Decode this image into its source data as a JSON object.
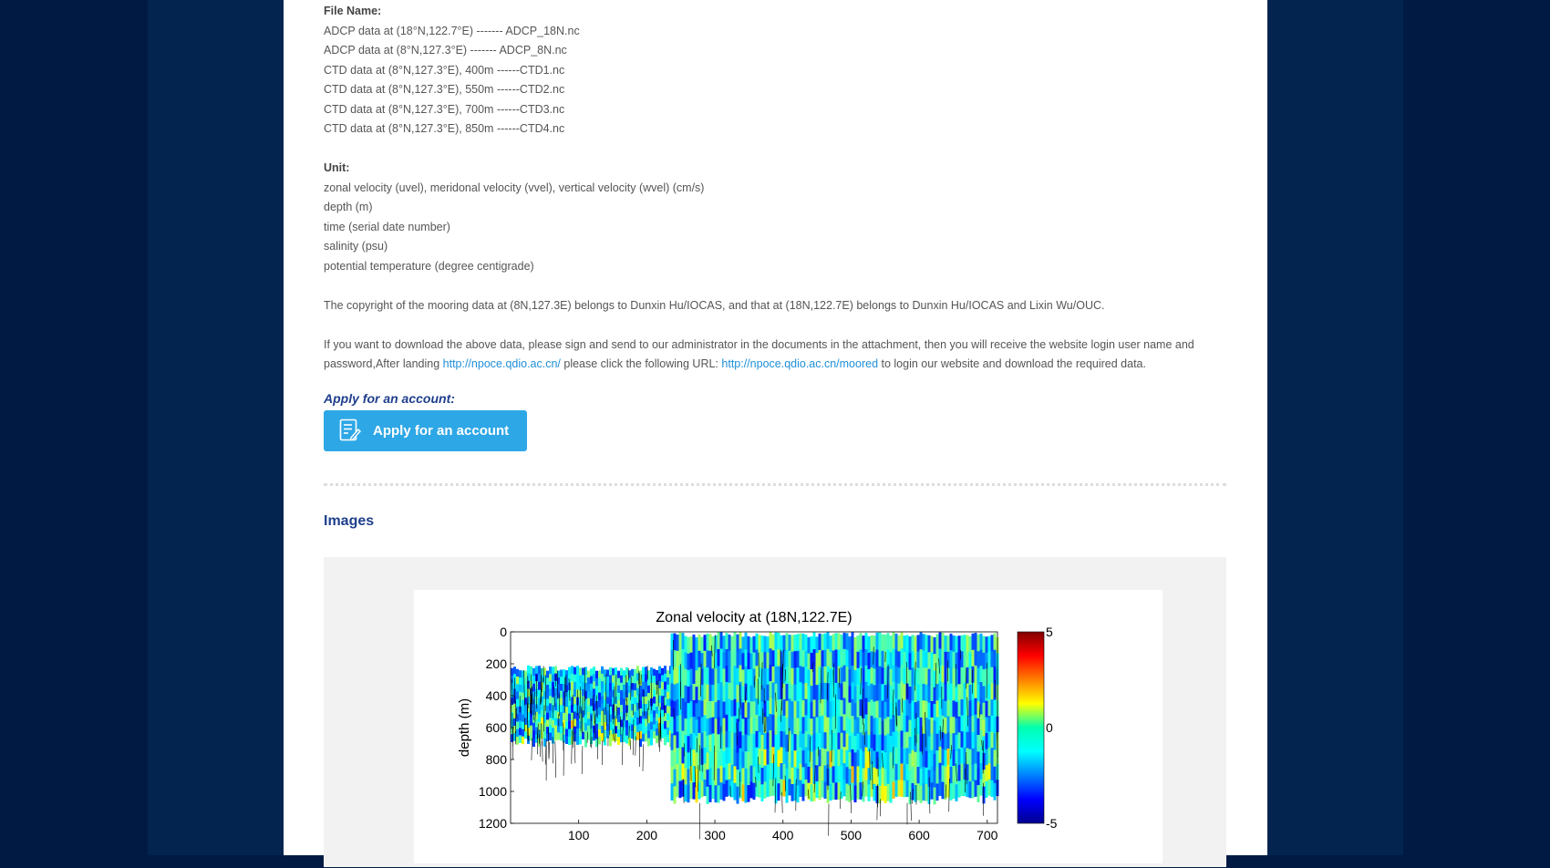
{
  "filenames": {
    "heading": "File Name:",
    "items": [
      "ADCP data at (18°N,122.7°E) ------- ADCP_18N.nc",
      "ADCP data at (8°N,127.3°E) ------- ADCP_8N.nc",
      "CTD data at (8°N,127.3°E), 400m ------CTD1.nc",
      "CTD data at (8°N,127.3°E), 550m ------CTD2.nc",
      "CTD data at (8°N,127.3°E), 700m ------CTD3.nc",
      "CTD data at (8°N,127.3°E), 850m ------CTD4.nc"
    ]
  },
  "units": {
    "heading": "Unit:",
    "items": [
      "zonal velocity (uvel), meridonal velocity (vvel), vertical velocity (wvel) (cm/s)",
      "depth (m)",
      "time (serial date number)",
      "salinity (psu)",
      "potential temperature (degree centigrade)"
    ]
  },
  "copyright": "The copyright of the mooring data at (8N,127.3E) belongs to Dunxin Hu/IOCAS, and that at (18N,122.7E) belongs to Dunxin Hu/IOCAS and Lixin Wu/OUC.",
  "download": {
    "text1": "If you want to download the above data, please sign and send to our administrator in the documents in the attachment, then you will receive the website login user name and password,After landing ",
    "link1": "http://npoce.qdio.ac.cn/",
    "text2": " please click the following URL:  ",
    "link2": "http://npoce.qdio.ac.cn/moored",
    "text3": " to login our website and download the required data."
  },
  "apply": {
    "title": "Apply for an account:",
    "button": "Apply for an account"
  },
  "images_title": "Images",
  "chart_data": {
    "type": "heatmap",
    "title": "Zonal velocity at (18N,122.7E)",
    "xlabel": "",
    "ylabel": "depth (m)",
    "xlim": [
      0,
      715
    ],
    "ylim": [
      1200,
      0
    ],
    "x_ticks": [
      100,
      200,
      300,
      400,
      500,
      600,
      700
    ],
    "y_ticks": [
      0,
      200,
      400,
      600,
      800,
      1000,
      1200
    ],
    "colorbar": {
      "min": -5,
      "max": 5,
      "ticks": [
        5,
        0,
        -5
      ],
      "colormap": "jet"
    },
    "segments": [
      {
        "x_start": 0,
        "x_end": 235,
        "depth_top": 210,
        "depth_bottom": 720,
        "dominant_value": -1.5
      },
      {
        "x_start": 235,
        "x_end": 715,
        "depth_top": 0,
        "depth_bottom": 1080,
        "dominant_value": -1.5
      }
    ]
  }
}
